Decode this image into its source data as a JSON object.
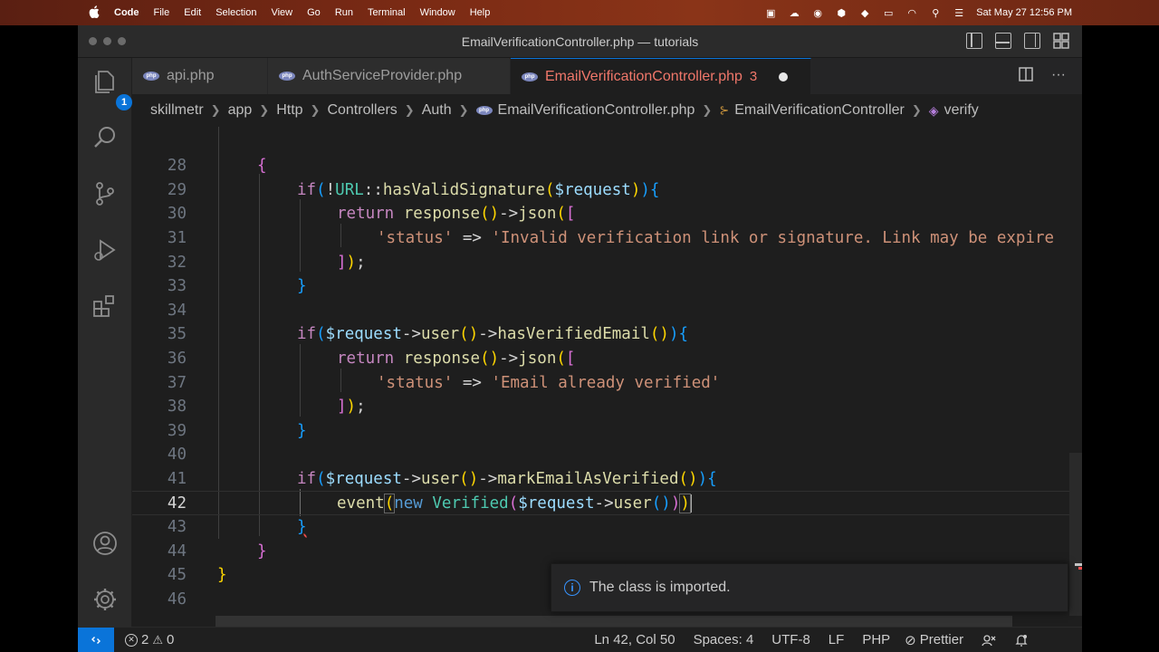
{
  "menubar": {
    "apple": "",
    "app_name": "Code",
    "items": [
      "File",
      "Edit",
      "Selection",
      "View",
      "Go",
      "Run",
      "Terminal",
      "Window",
      "Help"
    ],
    "datetime": "Sat May 27  12:56 PM"
  },
  "window": {
    "title": "EmailVerificationController.php — tutorials"
  },
  "activity": {
    "explorer_badge": "1"
  },
  "tabs": [
    {
      "label": "api.php",
      "active": false
    },
    {
      "label": "AuthServiceProvider.php",
      "active": false
    },
    {
      "label": "EmailVerificationController.php",
      "active": true,
      "problems": "3"
    }
  ],
  "breadcrumb": [
    "skillmetr",
    "app",
    "Http",
    "Controllers",
    "Auth",
    "EmailVerificationController.php",
    "EmailVerificationController",
    "verify"
  ],
  "editor": {
    "current_line": 42,
    "lines": [
      {
        "n": "28"
      },
      {
        "n": "29"
      },
      {
        "n": "30"
      },
      {
        "n": "31"
      },
      {
        "n": "32"
      },
      {
        "n": "33"
      },
      {
        "n": "34"
      },
      {
        "n": "35"
      },
      {
        "n": "36"
      },
      {
        "n": "37"
      },
      {
        "n": "38"
      },
      {
        "n": "39"
      },
      {
        "n": "40"
      },
      {
        "n": "41"
      },
      {
        "n": "42"
      },
      {
        "n": "43"
      },
      {
        "n": "44"
      },
      {
        "n": "45"
      },
      {
        "n": "46"
      }
    ],
    "code": {
      "l29_if": "if",
      "l29_bang": "!",
      "l29_cls": "URL",
      "l29_sep": "::",
      "l29_fn": "hasValidSignature",
      "l29_var": "$request",
      "l30_ret": "return",
      "l30_fn": "response",
      "l30_arrow": "->",
      "l30_json": "json",
      "l31_key": "'status'",
      "l31_arrow": " => ",
      "l31_val": "'Invalid verification link or signature. Link may be expire",
      "l35_if": "if",
      "l35_var": "$request",
      "l35_user": "user",
      "l35_fn": "hasVerifiedEmail",
      "l36_ret": "return",
      "l36_fn": "response",
      "l36_json": "json",
      "l37_key": "'status'",
      "l37_arrow": " => ",
      "l37_val": "'Email already verified'",
      "l41_if": "if",
      "l41_var": "$request",
      "l41_user": "user",
      "l41_fn": "markEmailAsVerified",
      "l42_event": "event",
      "l42_new": "new",
      "l42_cls": "Verified",
      "l42_var": "$request",
      "l42_user": "user"
    }
  },
  "notification": {
    "message": "The class is imported."
  },
  "statusbar": {
    "errors": "2",
    "warnings": "0",
    "position": "Ln 42, Col 50",
    "spaces": "Spaces: 4",
    "encoding": "UTF-8",
    "eol": "LF",
    "language": "PHP",
    "formatter": "Prettier"
  },
  "colors": {
    "accent": "#0a74d9",
    "tab_active_text": "#f0776a"
  }
}
